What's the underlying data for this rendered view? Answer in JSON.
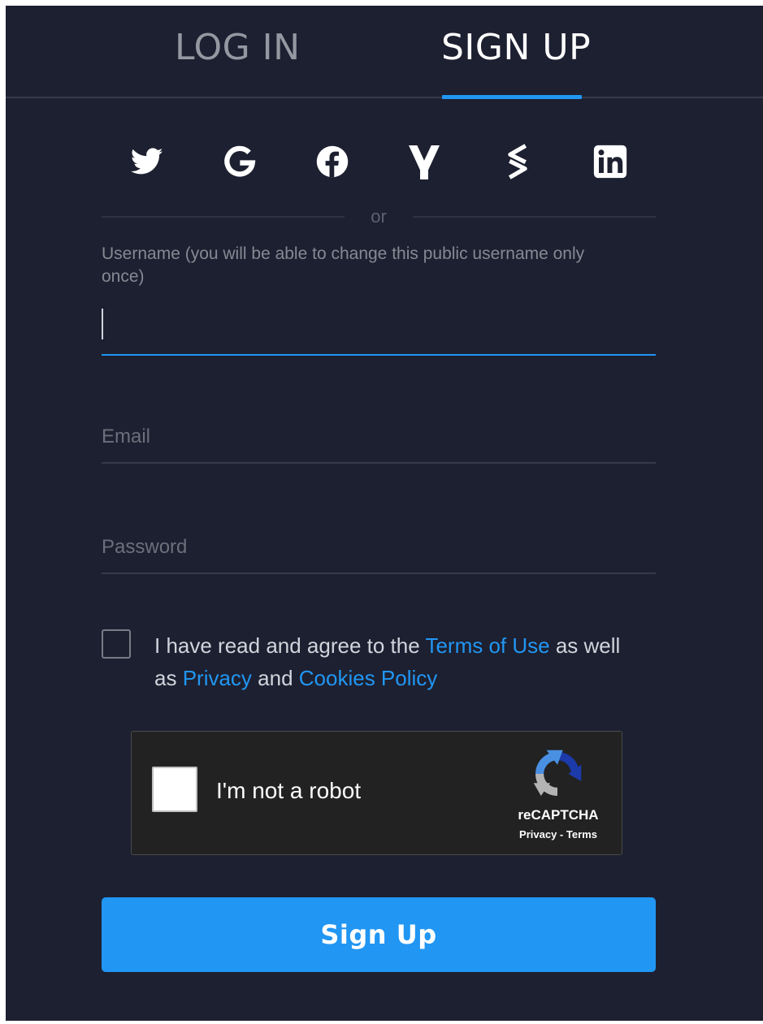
{
  "tabs": {
    "login": "LOG IN",
    "signup": "SIGN UP",
    "active": "signup"
  },
  "social_providers": [
    {
      "icon": "twitter-icon"
    },
    {
      "icon": "google-icon"
    },
    {
      "icon": "facebook-icon"
    },
    {
      "icon": "yahoo-icon"
    },
    {
      "icon": "stocktwits-icon"
    },
    {
      "icon": "linkedin-icon"
    }
  ],
  "divider": {
    "text": "or"
  },
  "form": {
    "username_label": "Username (you will be able to change this public username only once)",
    "username_value": "",
    "email_placeholder": "Email",
    "email_value": "",
    "password_placeholder": "Password",
    "password_value": ""
  },
  "agreement": {
    "checked": false,
    "part1": "I have read and agree to the ",
    "terms_link": "Terms of Use",
    "part2": " as well as ",
    "privacy_link": "Privacy",
    "part3": " and ",
    "cookies_link": "Cookies Policy"
  },
  "captcha": {
    "label": "I'm not a robot",
    "brand": "reCAPTCHA",
    "privacy": "Privacy",
    "separator": " - ",
    "terms": "Terms"
  },
  "submit": {
    "label": "Sign Up"
  },
  "colors": {
    "background": "#1d2030",
    "accent": "#2196f3",
    "text": "#d1d4dc",
    "muted": "#868993"
  }
}
